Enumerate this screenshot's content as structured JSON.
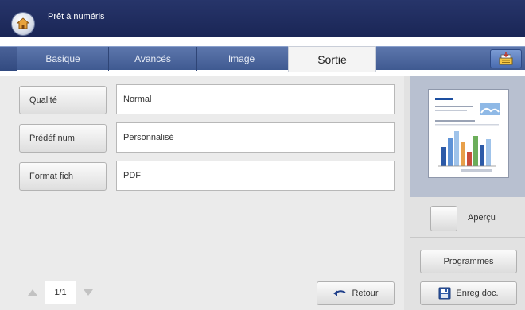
{
  "header": {
    "status": "Prêt à numéris",
    "home_icon": "home-icon"
  },
  "tabs": [
    {
      "label": "Basique",
      "active": false
    },
    {
      "label": "Avancés",
      "active": false
    },
    {
      "label": "Image",
      "active": false
    },
    {
      "label": "Sortie",
      "active": true
    }
  ],
  "tab_action_icon": "job-queue-icon",
  "fields": [
    {
      "button": "Qualité",
      "value": "Normal"
    },
    {
      "button": "Prédéf num",
      "value": "Personnalisé"
    },
    {
      "button": "Format fich",
      "value": "PDF"
    }
  ],
  "pager": {
    "page": "1/1"
  },
  "actions": {
    "retour": "Retour",
    "apercu": "Aperçu",
    "programmes": "Programmes",
    "enreg": "Enreg doc."
  },
  "colors": {
    "topbar": "#1f2b5e",
    "tabbar": "#4d6aa1",
    "active_tab": "#f4f4f4"
  }
}
